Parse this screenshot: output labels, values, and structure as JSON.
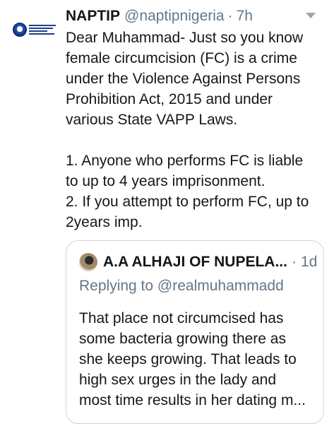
{
  "tweet": {
    "author_name": "NAPTIP",
    "author_handle": "@naptipnigeria",
    "separator": "·",
    "time": "7h",
    "lines": [
      "Dear Muhammad- Just so you know",
      "female circumcision (FC) is a crime",
      "under the Violence Against Persons",
      "Prohibition Act, 2015 and under",
      "various State VAPP Laws.",
      "",
      "1. Anyone who performs FC is liable",
      "to up to 4 years imprisonment.",
      "2. If you attempt to perform FC, up to",
      "2years imp."
    ],
    "icons": {
      "avatar": "naptip-logo-icon",
      "more": "chevron-down-icon"
    }
  },
  "quoted": {
    "author_name": "A.A ALHAJI OF NUPELA...",
    "separator": "·",
    "time": "1d",
    "replying_to": "Replying to @realmuhammadd",
    "lines": [
      "That place not circumcised has",
      "some bacteria growing there as",
      "she keeps growing. That leads to",
      "high sex urges in the lady and",
      "most time results in her dating m..."
    ],
    "icons": {
      "avatar": "user-avatar-icon"
    }
  },
  "colors": {
    "text": "#14171a",
    "secondary": "#657786",
    "border": "#ccd6dd"
  }
}
